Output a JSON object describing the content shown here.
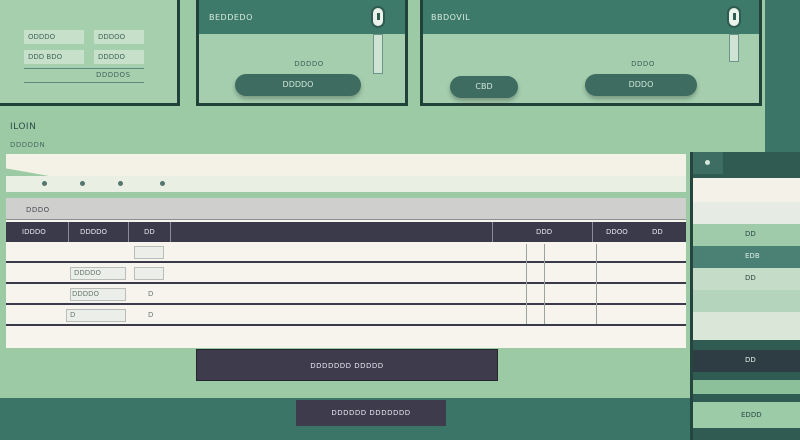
{
  "top_left": {
    "chips": [
      "ODDDO",
      "DDDOO",
      "DDD BDO",
      "DDDDO"
    ],
    "caption": "DDDDOS"
  },
  "panel_a": {
    "header": "BEDDEDO",
    "pill_label": "DDDDO",
    "pill": "DDDDO"
  },
  "panel_b": {
    "header": "BBDOVIL",
    "left_pill": "CBD",
    "right_pill_label": "DDDO",
    "right_pill": "DDDO"
  },
  "main": {
    "title": "ILOIN",
    "subtitle": "DDDDDN",
    "section_label": "DDDO",
    "columns": [
      "IDDDO",
      "DDDDO",
      "DD",
      "DDD",
      "DDOO",
      "DD"
    ],
    "rows": [
      {
        "c1": "",
        "c2": "",
        "c3": ""
      },
      {
        "c1": "",
        "c2": "DDDDO",
        "c3": ""
      },
      {
        "c1": "",
        "c2": "DDDDO",
        "c3": "D"
      },
      {
        "c1": "",
        "c2": "D",
        "c3": "D"
      }
    ],
    "primary_button": "DDDDDDD DDDDD",
    "secondary_button": "DDDDDD DDDDDDD"
  },
  "side_list": {
    "items": [
      {
        "label": "",
        "bg": "#f4f2e8"
      },
      {
        "label": "",
        "bg": "#e6ece3"
      },
      {
        "label": "DD",
        "bg": "#9fcbab"
      },
      {
        "label": "EDB",
        "bg": "#4b8074"
      },
      {
        "label": "DD",
        "bg": "#c5dcc9"
      },
      {
        "label": "",
        "bg": "#b4d4bb"
      },
      {
        "label": "",
        "bg": "#d9e6d8"
      },
      {
        "label": "DD",
        "bg": "#2e3d44"
      },
      {
        "label": "",
        "bg": "#8cc09a"
      },
      {
        "label": "EDDD",
        "bg": "#9ccba8"
      }
    ]
  },
  "colors": {
    "dark_teal": "#21423a",
    "mid_teal": "#3d7a6a",
    "mint": "#9ccaa5",
    "cream": "#f4f1e6",
    "navy": "#3b3a4a"
  }
}
